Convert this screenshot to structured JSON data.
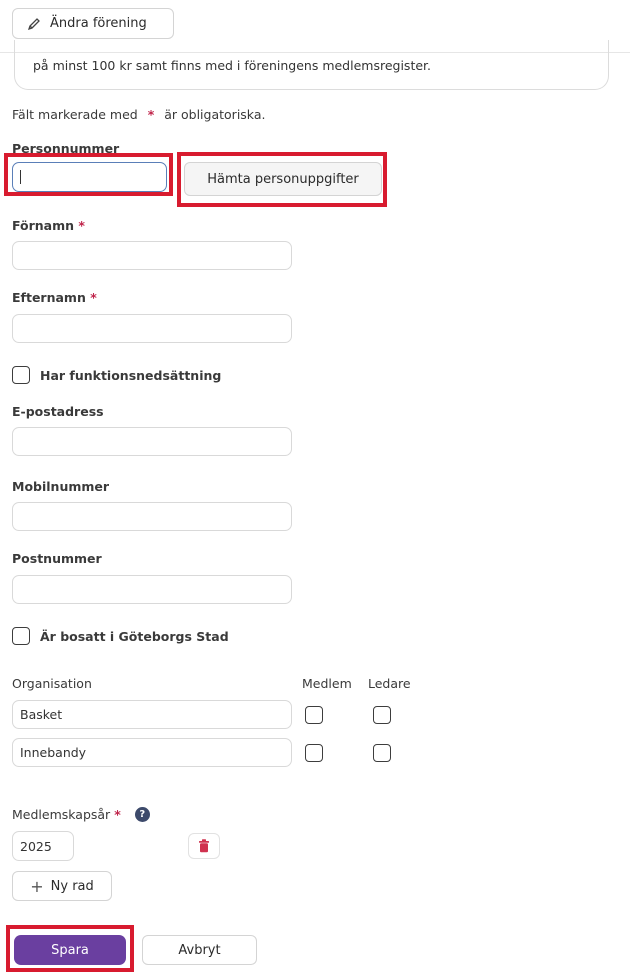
{
  "header": {
    "edit_association": "Ändra förening"
  },
  "info_box": {
    "text": "på minst 100 kr samt finns med i föreningens medlemsregister."
  },
  "required_note": {
    "prefix": "Fält markerade med",
    "star": "*",
    "suffix": "är obligatoriska."
  },
  "fields": {
    "personnummer": {
      "label": "Personnummer",
      "value": ""
    },
    "fetch_button": "Hämta personuppgifter",
    "fornamn": {
      "label": "Förnamn",
      "value": ""
    },
    "efternamn": {
      "label": "Efternamn",
      "value": ""
    },
    "disability": {
      "label": "Har funktionsnedsättning",
      "checked": false
    },
    "epost": {
      "label": "E-postadress",
      "value": ""
    },
    "mobil": {
      "label": "Mobilnummer",
      "value": ""
    },
    "postnummer": {
      "label": "Postnummer",
      "value": ""
    },
    "resident": {
      "label": "Är bosatt i Göteborgs Stad",
      "checked": false
    }
  },
  "organisations": {
    "headers": {
      "org": "Organisation",
      "member": "Medlem",
      "leader": "Ledare"
    },
    "rows": [
      {
        "name": "Basket",
        "member": false,
        "leader": false
      },
      {
        "name": "Innebandy",
        "member": false,
        "leader": false
      }
    ]
  },
  "membership": {
    "label": "Medlemskapsår",
    "year": "2025",
    "add_row": "Ny rad"
  },
  "actions": {
    "save": "Spara",
    "cancel": "Avbryt"
  },
  "colors": {
    "accent": "#6a3fa0",
    "required": "#c0254b",
    "highlight": "#d81b2f"
  },
  "icons": [
    "pencil-icon",
    "help-icon",
    "trash-icon",
    "plus-icon"
  ]
}
